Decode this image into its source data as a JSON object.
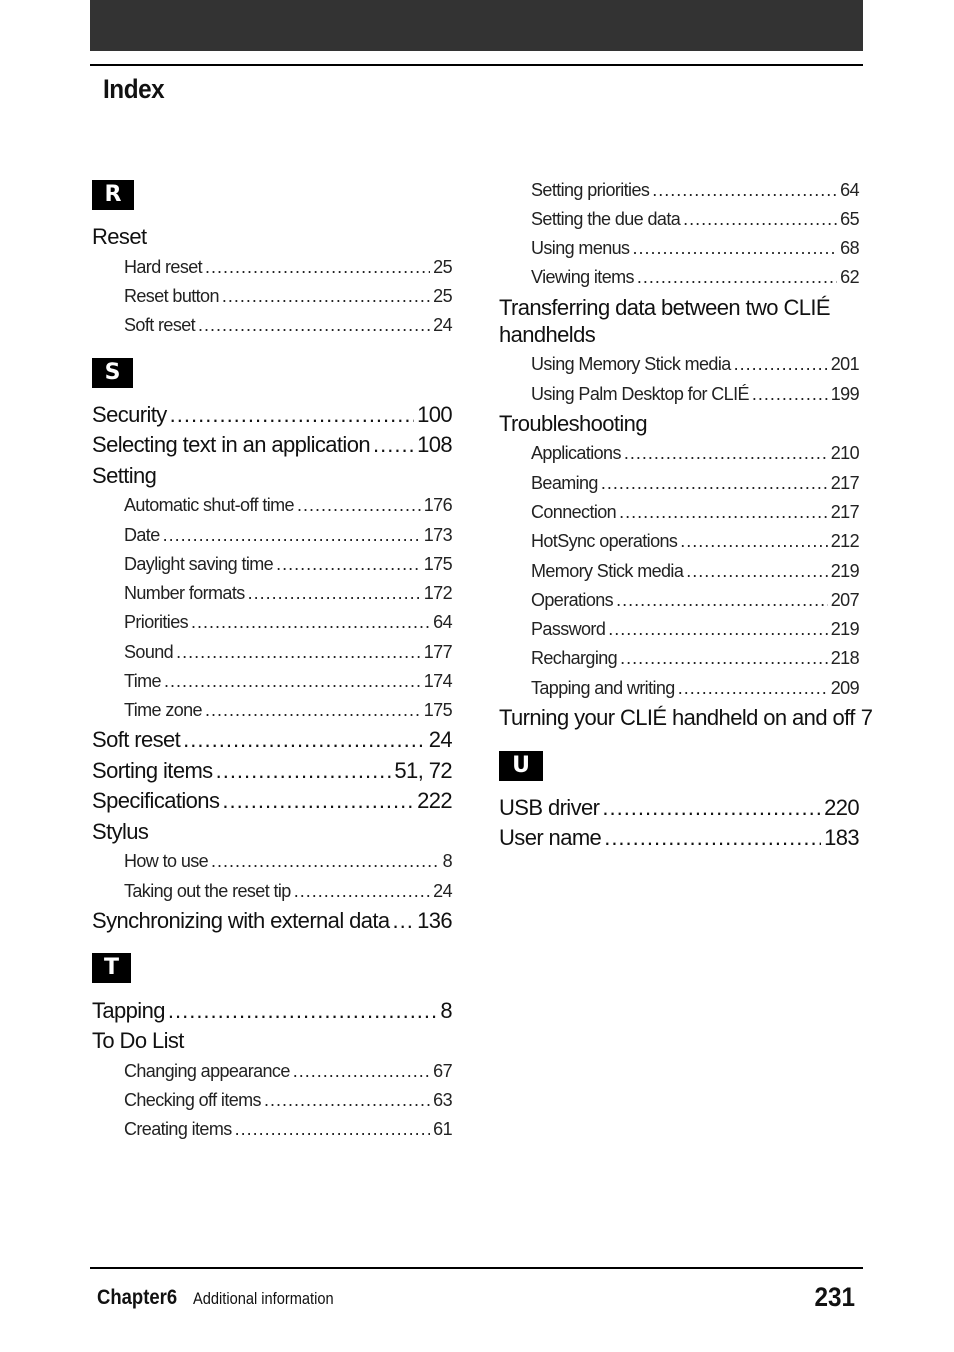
{
  "header": {
    "title": "Index"
  },
  "footer": {
    "chapter": "Chapter6",
    "section": "Additional information",
    "page_number": "231"
  },
  "sections": {
    "R": {
      "letter": "R",
      "entries": [
        {
          "label": "Reset",
          "sub": [
            {
              "label": "Hard reset",
              "page": "25"
            },
            {
              "label": "Reset button",
              "page": "25"
            },
            {
              "label": "Soft reset",
              "page": "24"
            }
          ]
        }
      ]
    },
    "S": {
      "letter": "S",
      "entries": [
        {
          "label": "Security",
          "page": "100"
        },
        {
          "label": "Selecting text in an application",
          "page": "108"
        },
        {
          "label": "Setting",
          "sub": [
            {
              "label": "Automatic shut-off time",
              "page": "176"
            },
            {
              "label": "Date",
              "page": "173"
            },
            {
              "label": "Daylight saving time",
              "page": "175"
            },
            {
              "label": "Number formats",
              "page": "172"
            },
            {
              "label": "Priorities",
              "page": "64"
            },
            {
              "label": "Sound",
              "page": "177"
            },
            {
              "label": "Time",
              "page": "174"
            },
            {
              "label": "Time zone",
              "page": "175"
            }
          ]
        },
        {
          "label": "Soft reset",
          "page": "24"
        },
        {
          "label": "Sorting items",
          "page": "51,  72"
        },
        {
          "label": "Specifications",
          "page": "222"
        },
        {
          "label": "Stylus",
          "sub": [
            {
              "label": "How to use",
              "page": "8"
            },
            {
              "label": "Taking out the reset tip",
              "page": "24"
            }
          ]
        },
        {
          "label": "Synchronizing with external data",
          "page": "136"
        }
      ]
    },
    "T": {
      "letter": "T",
      "entries": [
        {
          "label": "Tapping",
          "page": "8"
        },
        {
          "label": "To Do List",
          "sub": [
            {
              "label": "Changing appearance",
              "page": "67"
            },
            {
              "label": "Checking off items",
              "page": "63"
            },
            {
              "label": "Creating items",
              "page": "61"
            },
            {
              "label": "Setting priorities",
              "page": "64"
            },
            {
              "label": "Setting the due data",
              "page": "65"
            },
            {
              "label": "Using menus",
              "page": "68"
            },
            {
              "label": "Viewing items",
              "page": "62"
            }
          ]
        },
        {
          "label_line1": "Transferring data between two CLIÉ",
          "label_line2": "handhelds",
          "sub": [
            {
              "label": "Using Memory Stick media",
              "page": "201"
            },
            {
              "label": "Using Palm Desktop for CLIÉ",
              "page": "199"
            }
          ]
        },
        {
          "label": "Troubleshooting",
          "sub": [
            {
              "label": "Applications",
              "page": "210"
            },
            {
              "label": "Beaming",
              "page": "217"
            },
            {
              "label": "Connection",
              "page": "217"
            },
            {
              "label": "HotSync operations",
              "page": "212"
            },
            {
              "label": "Memory Stick media",
              "page": "219"
            },
            {
              "label": "Operations",
              "page": "207"
            },
            {
              "label": "Password",
              "page": "219"
            },
            {
              "label": "Recharging",
              "page": "218"
            },
            {
              "label": "Tapping and writing",
              "page": "209"
            }
          ]
        },
        {
          "label": "Turning  your CLIÉ handheld on and off",
          "page": "7"
        }
      ]
    },
    "U": {
      "letter": "U",
      "entries": [
        {
          "label": "USB driver",
          "page": "220"
        },
        {
          "label": "User name",
          "page": "183"
        }
      ]
    }
  }
}
